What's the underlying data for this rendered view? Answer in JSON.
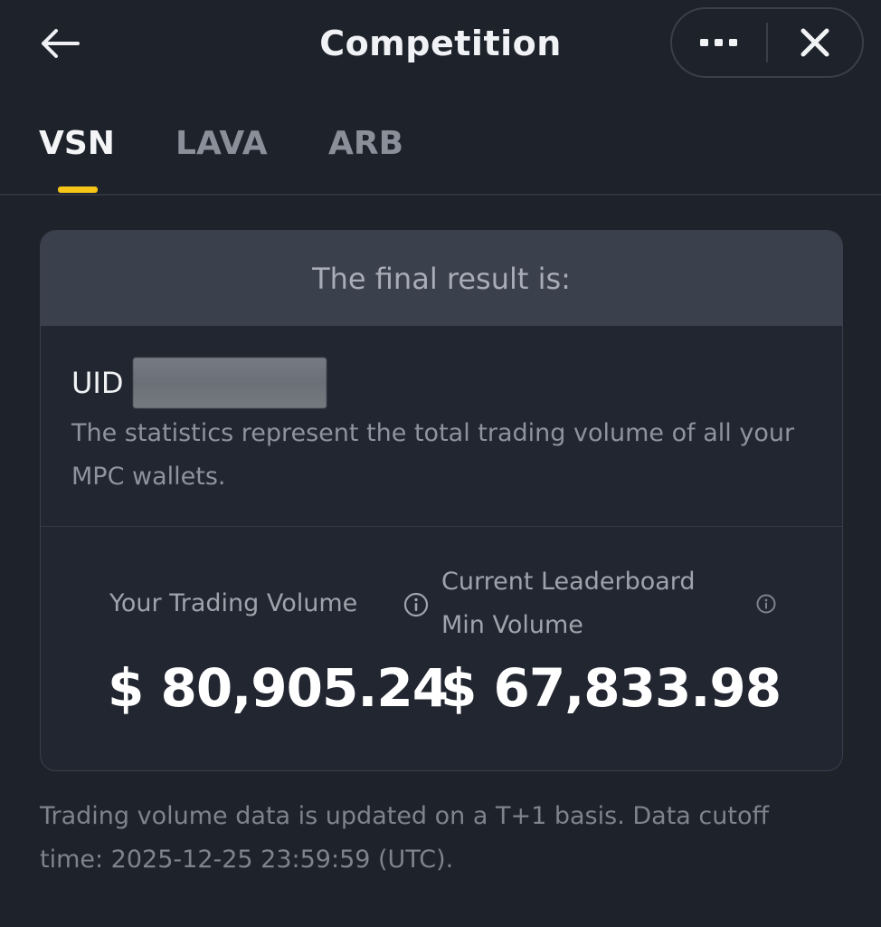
{
  "header": {
    "title": "Competition",
    "back_icon": "arrow-left-icon",
    "more_icon": "more-dots-icon",
    "close_icon": "close-icon"
  },
  "tabs": [
    {
      "label": "VSN",
      "active": true
    },
    {
      "label": "LAVA",
      "active": false
    },
    {
      "label": "ARB",
      "active": false
    }
  ],
  "colors": {
    "background": "#1e222b",
    "accent": "#f5c518",
    "card_header": "#3a404c"
  },
  "card": {
    "header": "The final result is:",
    "uid_label": "UID",
    "description": "The statistics represent the total trading volume of all your MPC wallets.",
    "your_volume_label": "Your Trading Volume",
    "your_volume_value": "$ 80,905.24",
    "leaderboard_label": "Current Leaderboard Min Volume",
    "leaderboard_value": "$ 67,833.98"
  },
  "footer": {
    "note": "Trading volume data is updated on a T+1 basis. Data cutoff time: 2025-12-25 23:59:59 (UTC)."
  }
}
